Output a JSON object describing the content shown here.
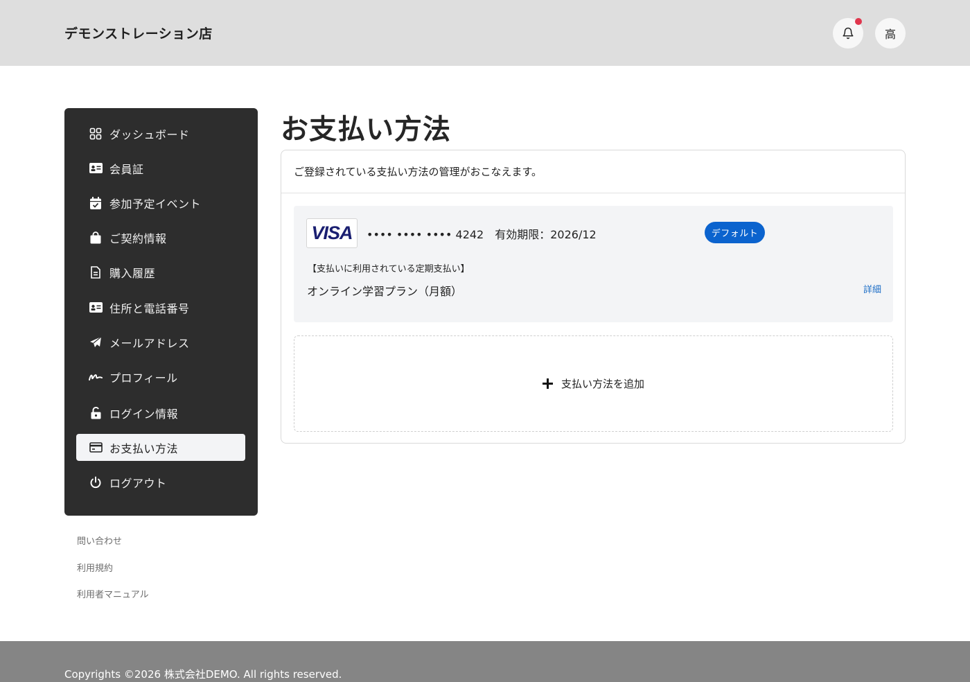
{
  "header": {
    "store_name": "デモンストレーション店",
    "avatar_initial": "高"
  },
  "sidebar": {
    "items": [
      {
        "label": "ダッシュボード",
        "icon": "grid-icon"
      },
      {
        "label": "会員証",
        "icon": "id-card-icon"
      },
      {
        "label": "参加予定イベント",
        "icon": "calendar-check-icon"
      },
      {
        "label": "ご契約情報",
        "icon": "shopping-bag-icon"
      },
      {
        "label": "購入履歴",
        "icon": "document-icon"
      },
      {
        "label": "住所と電話番号",
        "icon": "address-card-icon"
      },
      {
        "label": "メールアドレス",
        "icon": "paper-plane-icon"
      },
      {
        "label": "プロフィール",
        "icon": "signature-icon"
      },
      {
        "label": "ログイン情報",
        "icon": "unlock-icon"
      },
      {
        "label": "お支払い方法",
        "icon": "credit-card-icon",
        "active": true
      },
      {
        "label": "ログアウト",
        "icon": "power-icon"
      }
    ]
  },
  "side_links": [
    "問い合わせ",
    "利用規約",
    "利用者マニュアル"
  ],
  "main": {
    "title": "お支払い方法",
    "description": "ご登録されている支払い方法の管理がおこなえます。",
    "card": {
      "brand": "VISA",
      "number_text": "•••• •••• •••• 4242　有効期限：2026/12",
      "badge": "デフォルト",
      "sub_heading": "【支払いに利用されている定期支払い】",
      "plan": "オンライン学習プラン（月額）",
      "detail_link": "詳細"
    },
    "add_label": "支払い方法を追加"
  },
  "footer": {
    "copyright": "Copyrights ©2026 株式会社DEMO. All rights reserved."
  },
  "colors": {
    "topbar": "#dedede",
    "sidebar": "#2d2d2d",
    "badge": "#0b63ce",
    "visa": "#1a1f71",
    "notif_dot": "#e0364d",
    "footer": "#858585"
  }
}
